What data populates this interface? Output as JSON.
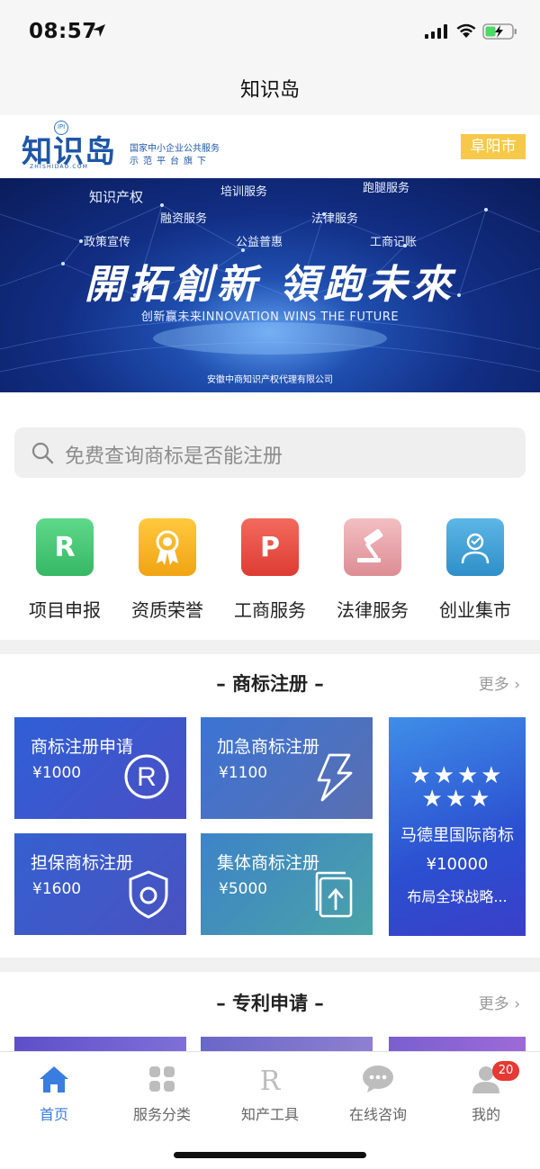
{
  "status_bar": {
    "time": "08:57"
  },
  "nav": {
    "title": "知识岛"
  },
  "brand": {
    "logo_text": "知识岛",
    "logo_badge": "IPI",
    "logo_sub": "ZHISHIDAO.COM",
    "tagline_1": "国家中小企业公共服务",
    "tagline_2": "示范平台旗下",
    "city": "阜阳市"
  },
  "banner": {
    "tags": [
      "知识产权",
      "培训服务",
      "跑腿服务",
      "融资服务",
      "法律服务",
      "政策宣传",
      "公益普惠",
      "工商记账"
    ],
    "slogan": "開拓創新 領跑未來",
    "subtitle": "创新赢未来INNOVATION WINS THE FUTURE",
    "company": "安徽中商知识产权代理有限公司"
  },
  "search": {
    "placeholder": "免费查询商标是否能注册"
  },
  "categories": [
    {
      "label": "项目申报",
      "icon": "r-icon",
      "glyph": "R",
      "color": "#43c46f"
    },
    {
      "label": "资质荣誉",
      "icon": "award-icon",
      "glyph": "",
      "color": "#f5b324"
    },
    {
      "label": "工商服务",
      "icon": "p-icon",
      "glyph": "P",
      "color": "#ea4e45"
    },
    {
      "label": "法律服务",
      "icon": "gavel-icon",
      "glyph": "",
      "color": "#e8a2a8"
    },
    {
      "label": "创业集市",
      "icon": "person-icon",
      "glyph": "",
      "color": "#3d9ed6"
    }
  ],
  "trademark": {
    "title": "– 商标注册 –",
    "more": "更多 ›",
    "cards": [
      {
        "name": "商标注册申请",
        "price": "¥1000",
        "icon": "registered-icon"
      },
      {
        "name": "加急商标注册",
        "price": "¥1100",
        "icon": "lightning-icon"
      },
      {
        "name": "担保商标注册",
        "price": "¥1600",
        "icon": "shield-icon"
      },
      {
        "name": "集体商标注册",
        "price": "¥5000",
        "icon": "upload-docs-icon"
      }
    ],
    "featured": {
      "stars": "★★★★★★★",
      "name": "马德里国际商标",
      "price": "¥10000",
      "desc": "布局全球战略..."
    }
  },
  "patent": {
    "title": "– 专利申请 –",
    "more": "更多 ›"
  },
  "tabs": [
    {
      "label": "首页",
      "icon": "home-icon",
      "active": true
    },
    {
      "label": "服务分类",
      "icon": "grid-icon",
      "active": false
    },
    {
      "label": "知产工具",
      "icon": "r-tool-icon",
      "active": false
    },
    {
      "label": "在线咨询",
      "icon": "chat-icon",
      "active": false
    },
    {
      "label": "我的",
      "icon": "user-icon",
      "active": false,
      "badge": "20"
    }
  ],
  "colors": {
    "accent": "#3a7de0",
    "brand_blue": "#1e57a8",
    "city_badge": "#f7c94a",
    "badge_red": "#e53935"
  }
}
